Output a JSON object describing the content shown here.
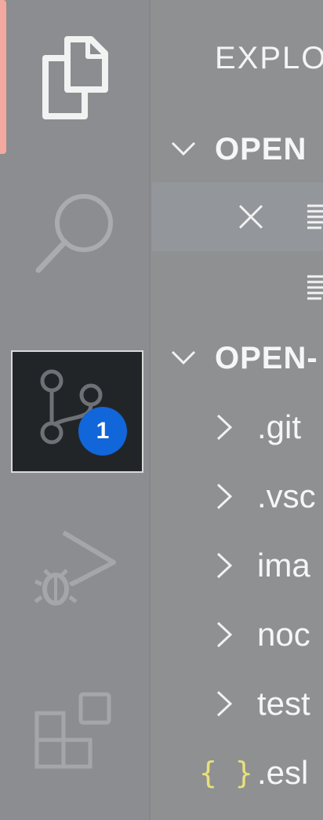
{
  "activity_bar": {
    "items": [
      {
        "name": "explorer",
        "icon": "files-icon",
        "active": true
      },
      {
        "name": "search",
        "icon": "search-icon"
      },
      {
        "name": "source-control",
        "icon": "source-control-icon",
        "badge": "1",
        "hovered": true
      },
      {
        "name": "run-and-debug",
        "icon": "run-debug-icon"
      },
      {
        "name": "extensions",
        "icon": "extensions-icon"
      }
    ],
    "colors": {
      "indicator": "#f3a99f",
      "badge": "#1166d9",
      "hover_bg": "#222528"
    }
  },
  "sidebar": {
    "title": "EXPLO",
    "sections": [
      {
        "label": "OPEN",
        "expanded": true
      },
      {
        "label": "OPEN-",
        "expanded": true
      }
    ],
    "items": [
      {
        "label": ".git",
        "type": "folder"
      },
      {
        "label": ".vsc",
        "type": "folder"
      },
      {
        "label": "ima",
        "type": "folder"
      },
      {
        "label": "noc",
        "type": "folder"
      },
      {
        "label": "test",
        "type": "folder"
      },
      {
        "label": ".esl",
        "type": "json-file",
        "icon_text": "{ }"
      }
    ]
  }
}
